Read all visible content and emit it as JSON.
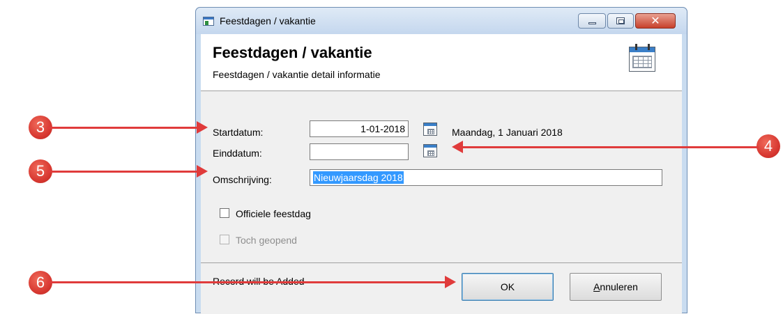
{
  "window": {
    "title": "Feestdagen / vakantie",
    "controls": {
      "minimize": "minimize",
      "maximize": "maximize",
      "close": "close"
    }
  },
  "header": {
    "title": "Feestdagen / vakantie",
    "subtitle": "Feestdagen / vakantie detail informatie"
  },
  "form": {
    "startdatum_label": "Startdatum:",
    "startdatum_value": "1-01-2018",
    "startdatum_text": "Maandag, 1 Januari 2018",
    "einddatum_label": "Einddatum:",
    "einddatum_value": "",
    "omschrijving_label": "Omschrijving:",
    "omschrijving_value": "Nieuwjaarsdag 2018",
    "officiele_label": "Officiele feestdag",
    "officiele_checked": false,
    "toch_label": "Toch geopend",
    "toch_checked": false
  },
  "footer": {
    "status": "Record will be Added",
    "ok_label": "OK",
    "cancel_label": "Annuleren"
  },
  "annotations": [
    {
      "number": "3"
    },
    {
      "number": "4"
    },
    {
      "number": "5"
    },
    {
      "number": "6"
    }
  ],
  "colors": {
    "annotation": "#e03b3b",
    "selection": "#3399ff",
    "close": "#c7402b"
  },
  "icons": [
    "app-icon",
    "calendar-icon",
    "minimize-icon",
    "maximize-icon",
    "close-icon"
  ]
}
